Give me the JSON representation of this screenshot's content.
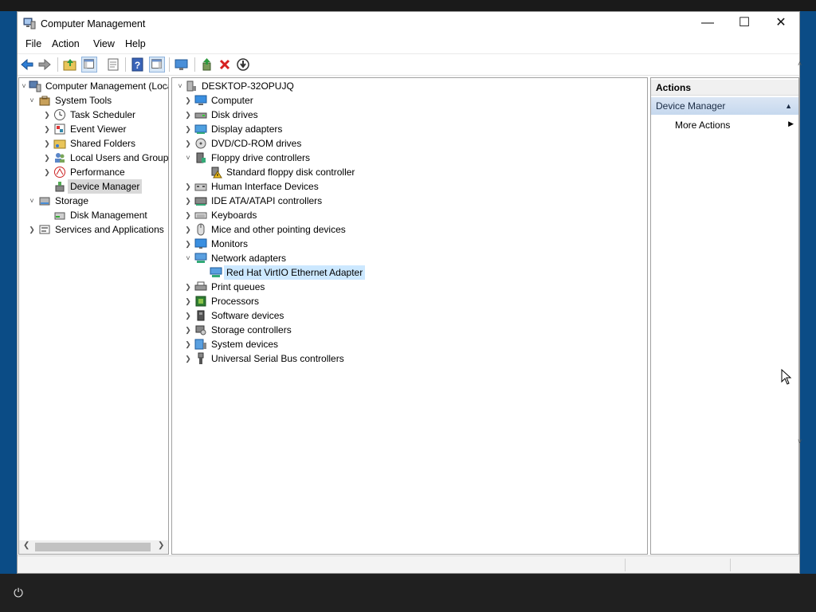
{
  "window": {
    "title": "Computer Management"
  },
  "menu": [
    "File",
    "Action",
    "View",
    "Help"
  ],
  "toolbar": {
    "buttons": [
      "back-arrow-icon",
      "forward-arrow-icon",
      "up-folder-icon",
      "show-hide-tree-icon",
      "properties-icon",
      "help-icon",
      "show-action-pane-icon",
      "monitor-icon",
      "update-driver-icon",
      "uninstall-red-x-icon",
      "download-circle-icon"
    ]
  },
  "left_tree": {
    "root": "Computer Management (Local",
    "items": [
      {
        "label": "System Tools",
        "level": 1,
        "expander": "down",
        "icon": "toolbox-icon"
      },
      {
        "label": "Task Scheduler",
        "level": 2,
        "expander": "right",
        "icon": "clock-icon"
      },
      {
        "label": "Event Viewer",
        "level": 2,
        "expander": "right",
        "icon": "event-log-icon"
      },
      {
        "label": "Shared Folders",
        "level": 2,
        "expander": "right",
        "icon": "shared-folder-icon"
      },
      {
        "label": "Local Users and Groups",
        "level": 2,
        "expander": "right",
        "icon": "users-icon"
      },
      {
        "label": "Performance",
        "level": 2,
        "expander": "right",
        "icon": "performance-icon"
      },
      {
        "label": "Device Manager",
        "level": 2,
        "expander": "",
        "icon": "device-manager-icon",
        "selected": true
      },
      {
        "label": "Storage",
        "level": 1,
        "expander": "down",
        "icon": "storage-icon"
      },
      {
        "label": "Disk Management",
        "level": 2,
        "expander": "",
        "icon": "disk-management-icon"
      },
      {
        "label": "Services and Applications",
        "level": 1,
        "expander": "right",
        "icon": "services-icon"
      }
    ]
  },
  "device_tree": {
    "root": "DESKTOP-32OPUJQ",
    "items": [
      {
        "label": "Computer",
        "level": 1,
        "expander": "right",
        "icon": "computer-icon"
      },
      {
        "label": "Disk drives",
        "level": 1,
        "expander": "right",
        "icon": "disk-drive-icon"
      },
      {
        "label": "Display adapters",
        "level": 1,
        "expander": "right",
        "icon": "display-adapter-icon"
      },
      {
        "label": "DVD/CD-ROM drives",
        "level": 1,
        "expander": "right",
        "icon": "dvd-drive-icon"
      },
      {
        "label": "Floppy drive controllers",
        "level": 1,
        "expander": "down",
        "icon": "floppy-controller-icon"
      },
      {
        "label": "Standard floppy disk controller",
        "level": 2,
        "expander": "",
        "icon": "warning-device-icon"
      },
      {
        "label": "Human Interface Devices",
        "level": 1,
        "expander": "right",
        "icon": "hid-icon"
      },
      {
        "label": "IDE ATA/ATAPI controllers",
        "level": 1,
        "expander": "right",
        "icon": "ide-controller-icon"
      },
      {
        "label": "Keyboards",
        "level": 1,
        "expander": "right",
        "icon": "keyboard-icon"
      },
      {
        "label": "Mice and other pointing devices",
        "level": 1,
        "expander": "right",
        "icon": "mouse-icon"
      },
      {
        "label": "Monitors",
        "level": 1,
        "expander": "right",
        "icon": "monitor-icon"
      },
      {
        "label": "Network adapters",
        "level": 1,
        "expander": "down",
        "icon": "network-adapter-icon"
      },
      {
        "label": "Red Hat VirtIO Ethernet Adapter",
        "level": 2,
        "expander": "",
        "icon": "network-adapter-icon",
        "selected": true
      },
      {
        "label": "Print queues",
        "level": 1,
        "expander": "right",
        "icon": "printer-icon"
      },
      {
        "label": "Processors",
        "level": 1,
        "expander": "right",
        "icon": "processor-icon"
      },
      {
        "label": "Software devices",
        "level": 1,
        "expander": "right",
        "icon": "software-device-icon"
      },
      {
        "label": "Storage controllers",
        "level": 1,
        "expander": "right",
        "icon": "storage-controller-icon"
      },
      {
        "label": "System devices",
        "level": 1,
        "expander": "right",
        "icon": "system-devices-icon"
      },
      {
        "label": "Universal Serial Bus controllers",
        "level": 1,
        "expander": "right",
        "icon": "usb-icon"
      }
    ]
  },
  "actions": {
    "header": "Actions",
    "section": "Device Manager",
    "more": "More Actions"
  },
  "colors": {
    "desktop": "#0b4c86",
    "selection": "#cce8ff",
    "taskbar": "#202020"
  }
}
